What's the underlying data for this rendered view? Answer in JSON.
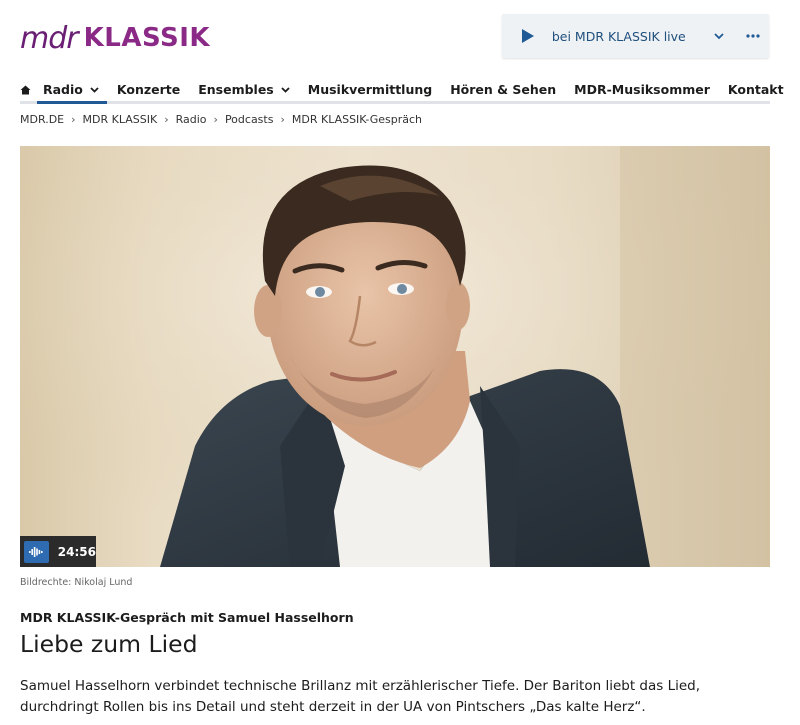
{
  "brand": {
    "mdr": "mdr",
    "klassik": "KLASSIK",
    "color": "#8b2a86"
  },
  "player": {
    "label": "bei MDR KLASSIK live",
    "play_icon": "play-icon",
    "chevron_icon": "chevron-down-icon",
    "more_icon": "more-icon",
    "accent": "#1f5a96"
  },
  "nav": {
    "home_icon": "home-icon",
    "items": [
      {
        "label": "Radio",
        "active": true,
        "has_dropdown": true
      },
      {
        "label": "Konzerte"
      },
      {
        "label": "Ensembles",
        "has_dropdown": true
      },
      {
        "label": "Musikvermittlung"
      },
      {
        "label": "Hören & Sehen"
      },
      {
        "label": "MDR-Musiksommer"
      },
      {
        "label": "Kontakt"
      }
    ]
  },
  "breadcrumb": [
    "MDR.DE",
    "MDR KLASSIK",
    "Radio",
    "Podcasts",
    "MDR KLASSIK-Gespräch"
  ],
  "media": {
    "duration": "24:56",
    "audio_icon": "audio-wave-icon",
    "credit": "Bildrechte: Nikolaj Lund"
  },
  "article": {
    "kicker": "MDR KLASSIK-Gespräch mit Samuel Hasselhorn",
    "headline": "Liebe zum Lied",
    "teaser": "Samuel Hasselhorn verbindet technische Brillanz mit erzählerischer Tiefe. Der Bariton liebt das Lied, durchdringt Rollen bis ins Detail und steht derzeit in der UA von Pintschers „Das kalte Herz“."
  }
}
